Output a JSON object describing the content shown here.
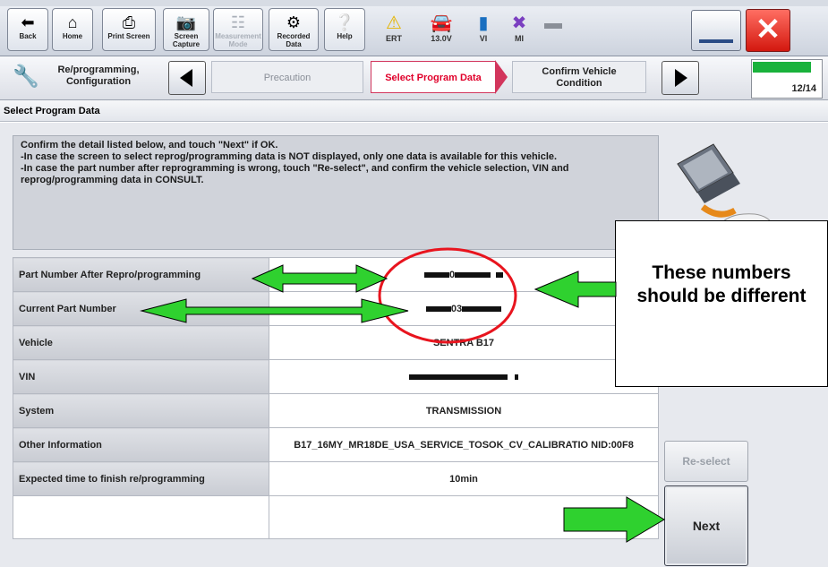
{
  "toolbar": {
    "buttons": [
      {
        "label": "Back",
        "icon": "back-arrow-icon"
      },
      {
        "label": "Home",
        "icon": "home-icon"
      },
      {
        "label": "Print Screen",
        "icon": "printer-icon"
      },
      {
        "label": "Screen Capture",
        "icon": "camera-icon"
      },
      {
        "label": "Measurement Mode",
        "icon": "measurement-icon"
      },
      {
        "label": "Recorded Data",
        "icon": "recorded-data-icon"
      },
      {
        "label": "Help",
        "icon": "help-icon"
      }
    ],
    "status": [
      {
        "label": "ERT",
        "icon": "warning-icon"
      },
      {
        "label": "13.0V",
        "icon": "car-battery-icon"
      },
      {
        "label": "VI",
        "icon": "signal-icon"
      },
      {
        "label": "MI",
        "icon": "mi-x-icon"
      }
    ]
  },
  "breadcrumb": {
    "first": "Re/programming, Configuration",
    "steps": [
      "Precaution",
      "Select Program Data",
      "Confirm Vehicle Condition"
    ],
    "progress": "12/14",
    "progress_fraction": 0.857
  },
  "page_title": "Select Program Data",
  "instructions": [
    "Confirm the detail listed below, and touch \"Next\" if OK.",
    "-In case the screen to select reprog/programming data is NOT displayed, only one data is available for this vehicle.",
    "-In case the part number after reprogramming is wrong, touch \"Re-select\", and confirm the vehicle selection, VIN and reprog/programming data in CONSULT."
  ],
  "rows": [
    {
      "key": "Part Number After Repro/programming",
      "value": "",
      "redacted": true
    },
    {
      "key": "Current Part Number",
      "value": "",
      "redacted": true
    },
    {
      "key": "Vehicle",
      "value": "SENTRA B17"
    },
    {
      "key": "VIN",
      "value": "",
      "redacted": true
    },
    {
      "key": "System",
      "value": "TRANSMISSION"
    },
    {
      "key": "Other Information",
      "value": "B17_16MY_MR18DE_USA_SERVICE_TOSOK_CV_CALIBRATIO NID:00F8"
    },
    {
      "key": "Expected time to finish re/programming",
      "value": "10min"
    }
  ],
  "buttons": {
    "reselect": "Re-select",
    "next": "Next"
  },
  "callout": "These numbers should be different",
  "colors": {
    "accent": "#e0002a",
    "arrow_green": "#2fd12f",
    "progress_green": "#19b23b"
  }
}
